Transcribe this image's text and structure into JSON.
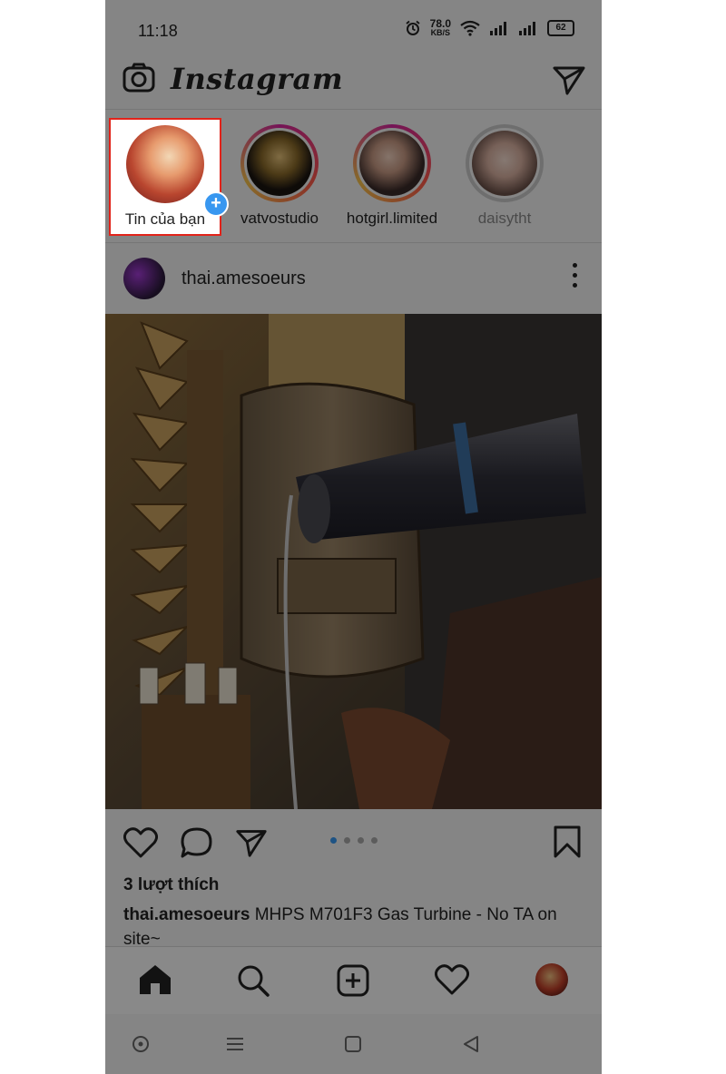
{
  "status_bar": {
    "time": "11:18",
    "net_speed_value": "78.0",
    "net_speed_unit": "KB/S",
    "battery": "62"
  },
  "app_bar": {
    "logo_text": "Instagram",
    "camera_icon": "camera-icon",
    "direct_icon": "paper-plane-icon"
  },
  "stories": [
    {
      "label": "Tin của bạn",
      "ring": "none",
      "has_plus": true
    },
    {
      "label": "vatvostudio",
      "ring": "gradient"
    },
    {
      "label": "hotgirl.limited",
      "ring": "gradient"
    },
    {
      "label": "daisytht",
      "ring": "grey"
    }
  ],
  "post": {
    "username": "thai.amesoeurs",
    "more_icon": "more-vertical-icon",
    "likes": "3 lượt thích",
    "caption_user": "thai.amesoeurs",
    "caption_text": "MHPS M701F3 Gas Turbine - No TA on site~",
    "carousel_pages": 4,
    "carousel_active": 1
  },
  "actions": {
    "like_icon": "heart-icon",
    "comment_icon": "comment-icon",
    "share_icon": "paper-plane-icon",
    "save_icon": "bookmark-icon"
  },
  "bottom_nav": [
    "home-icon",
    "search-icon",
    "add-post-icon",
    "activity-heart-icon",
    "profile-avatar"
  ],
  "system_nav": [
    "system-home-circle-icon",
    "recents-menu-icon",
    "overview-square-icon",
    "back-triangle-icon"
  ],
  "colors": {
    "highlight_border": "#e2231a",
    "accent_blue": "#3897f0",
    "overlay": "rgba(0,0,0,0.45)"
  }
}
